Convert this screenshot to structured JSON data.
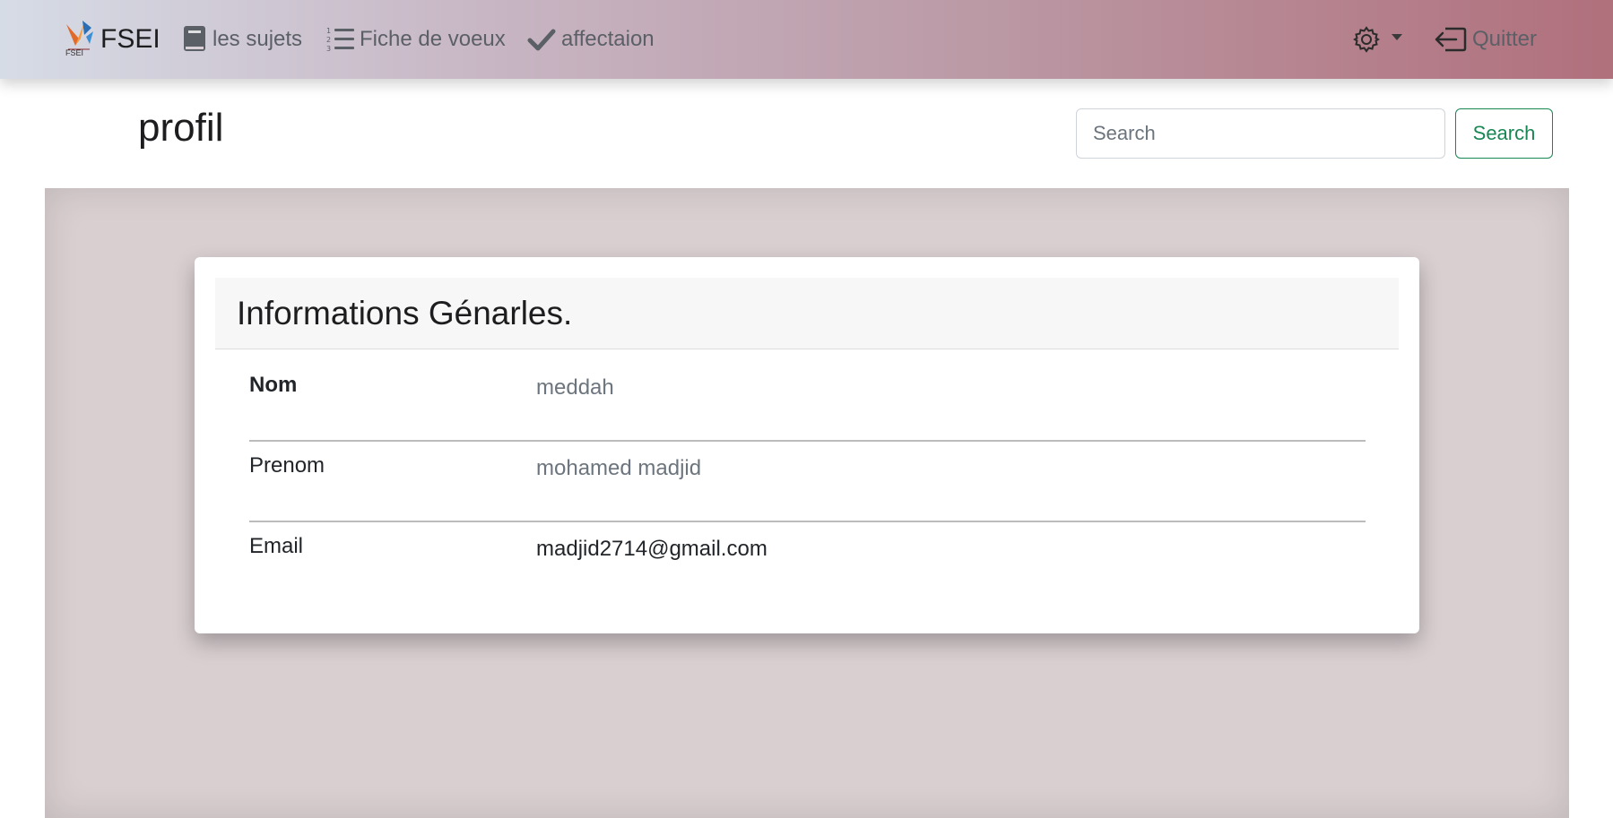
{
  "navbar": {
    "brand_name": "FSEI",
    "logo_caption": "FSEI",
    "items": [
      {
        "label": "les sujets",
        "icon": "book-icon"
      },
      {
        "label": "Fiche de voeux",
        "icon": "numbered-list-icon"
      },
      {
        "label": "affectaion",
        "icon": "checkmark-icon"
      }
    ],
    "settings_icon": "gear-icon",
    "quit_label": "Quitter",
    "quit_icon": "logout-icon"
  },
  "page": {
    "title": "profil"
  },
  "search": {
    "placeholder": "Search",
    "button_label": "Search"
  },
  "card": {
    "header": "Informations Génarles.",
    "rows": [
      {
        "label": "Nom",
        "value": "meddah"
      },
      {
        "label": "Prenom",
        "value": "mohamed madjid"
      },
      {
        "label": "Email",
        "value": "madjid2714@gmail.com"
      }
    ]
  },
  "colors": {
    "navbar_start": "#d6dce6",
    "navbar_end": "#b0707c",
    "search_button": "#198754",
    "content_background": "#d9cfd1",
    "muted_text": "#6c757d"
  }
}
